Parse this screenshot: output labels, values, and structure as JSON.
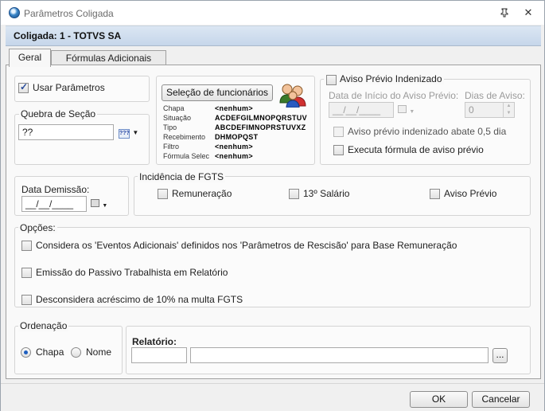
{
  "window": {
    "title": "Parâmetros Coligada"
  },
  "header": {
    "text": "Coligada: 1 - TOTVS SA"
  },
  "tabs": [
    {
      "label": "Geral"
    },
    {
      "label": "Fórmulas Adicionais"
    }
  ],
  "usar_parametros": {
    "label": "Usar Parâmetros",
    "checked": true
  },
  "quebra": {
    "title": "Quebra de Seção",
    "value": "??",
    "picker": "???"
  },
  "selecao": {
    "button": "Seleção de funcionários",
    "rows": [
      {
        "key": "Chapa",
        "value": "<nenhum>"
      },
      {
        "key": "Situação",
        "value": "ACDEFGILMNOPQRSTUV"
      },
      {
        "key": "Tipo",
        "value": "ABCDEFIMNOPRSTUVXZ"
      },
      {
        "key": "Recebimento",
        "value": "DHMOPQST"
      },
      {
        "key": "Filtro",
        "value": "<nenhum>"
      },
      {
        "key": "Fórmula Selec",
        "value": "<nenhum>"
      }
    ]
  },
  "aviso": {
    "title": "Aviso Prévio Indenizado",
    "data_inicio_label": "Data de Início do Aviso Prévio:",
    "data_inicio_value": "__/__/____",
    "dias_label": "Dias de Aviso:",
    "dias_value": "0",
    "abate_label": "Aviso prévio indenizado abate 0,5 dia",
    "formula_label": "Executa fórmula de aviso prévio"
  },
  "demissao": {
    "label": "Data Demissão:",
    "value": "__/__/____"
  },
  "fgts": {
    "title": "Incidência de FGTS",
    "remuneracao": "Remuneração",
    "decimo": "13º Salário",
    "aviso": "Aviso Prévio"
  },
  "opcoes": {
    "title": "Opções:",
    "items": [
      "Considera os 'Eventos Adicionais' definidos nos 'Parâmetros de Rescisão' para Base Remuneração",
      "Emissão do Passivo Trabalhista em Relatório",
      "Desconsidera acréscimo de 10% na multa FGTS"
    ]
  },
  "ordenacao": {
    "title": "Ordenação",
    "chapa": "Chapa",
    "nome": "Nome",
    "selected": "Chapa"
  },
  "relatorio": {
    "label": "Relatório:",
    "code": "",
    "name": "",
    "browse": "..."
  },
  "footer": {
    "ok": "OK",
    "cancel": "Cancelar"
  }
}
